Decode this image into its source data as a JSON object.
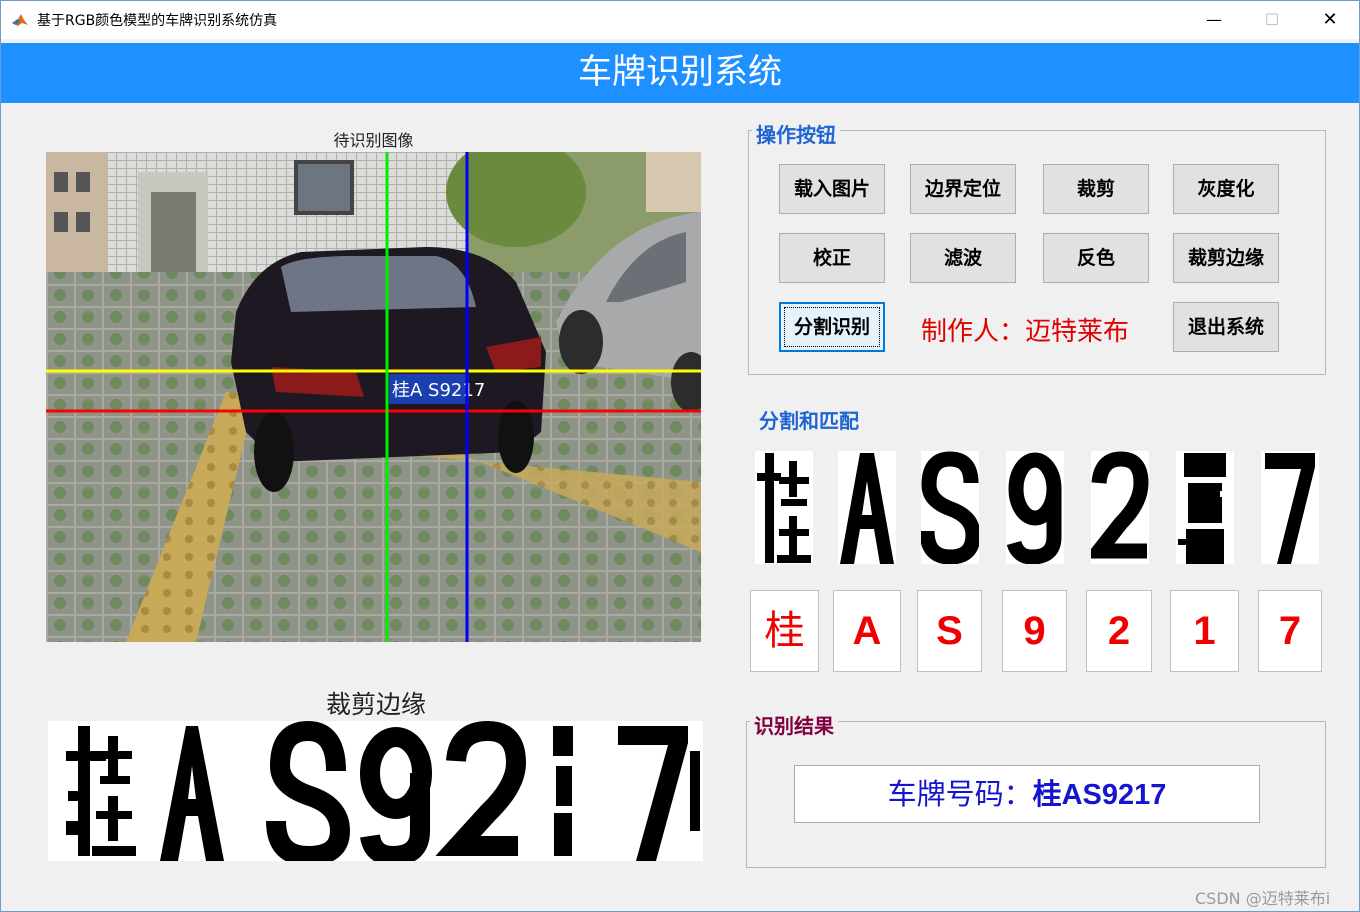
{
  "window": {
    "title": "基于RGB颜色模型的车牌识别系统仿真",
    "minimize_glyph": "—",
    "maximize_glyph": "☐",
    "close_glyph": "✕"
  },
  "banner": {
    "title": "车牌识别系统"
  },
  "image_panel": {
    "title": "待识别图像",
    "plate_text": "桂A S9217"
  },
  "crop_panel": {
    "title": "裁剪边缘"
  },
  "ops": {
    "title": "操作按钮",
    "buttons": [
      "载入图片",
      "边界定位",
      "裁剪",
      "灰度化",
      "校正",
      "滤波",
      "反色",
      "裁剪边缘",
      "分割识别",
      "退出系统"
    ],
    "author": "制作人：迈特莱布"
  },
  "segmentation": {
    "title": "分割和匹配",
    "segments": [
      "桂",
      "A",
      "S",
      "9",
      "2",
      "1",
      "7"
    ],
    "matched": [
      "桂",
      "A",
      "S",
      "9",
      "2",
      "1",
      "7"
    ]
  },
  "result": {
    "title": "识别结果",
    "label": "车牌号码：",
    "plate": "桂AS9217"
  },
  "watermark": "CSDN @迈特莱布i",
  "colors": {
    "banner": "#1e90ff",
    "panel_title_blue": "#1e64d2",
    "result_title": "#800040",
    "author": "#e00000",
    "result_text": "#1515d0",
    "match_text": "#f00000"
  }
}
